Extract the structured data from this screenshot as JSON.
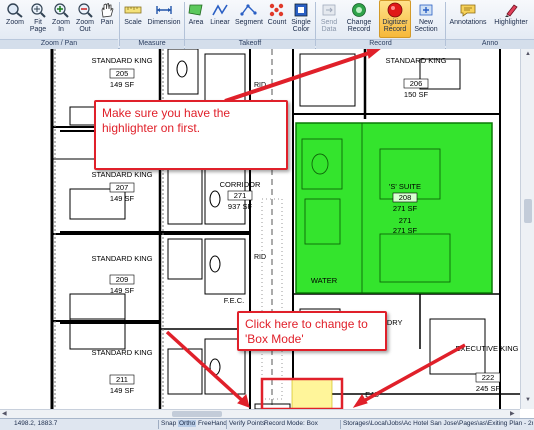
{
  "ribbon": {
    "buttons": [
      {
        "label": "Zoom",
        "icon": "zoom-icon"
      },
      {
        "label": "Fit Page",
        "icon": "fit-page-icon"
      },
      {
        "label": "Zoom In",
        "icon": "zoom-in-icon"
      },
      {
        "label": "Zoom Out",
        "icon": "zoom-out-icon"
      },
      {
        "label": "Pan",
        "icon": "pan-hand-icon"
      },
      {
        "label": "Scale",
        "icon": "scale-icon"
      },
      {
        "label": "Dimension",
        "icon": "dimension-icon"
      },
      {
        "label": "Area",
        "icon": "area-icon"
      },
      {
        "label": "Linear",
        "icon": "linear-icon"
      },
      {
        "label": "Segment",
        "icon": "segment-icon"
      },
      {
        "label": "Count",
        "icon": "count-icon"
      },
      {
        "label": "Single Color",
        "icon": "single-color-icon"
      },
      {
        "label": "Send Data",
        "icon": "send-data-icon"
      },
      {
        "label": "Change Record",
        "icon": "change-record-icon"
      },
      {
        "label": "Digitizer Record",
        "icon": "digitizer-record-icon"
      },
      {
        "label": "New Section",
        "icon": "new-section-icon"
      },
      {
        "label": "Annotations",
        "icon": "annotations-icon"
      },
      {
        "label": "Highlighter",
        "icon": "highlighter-icon"
      }
    ],
    "groups": [
      "Zoom / Pan",
      "Measure",
      "Takeoff",
      "Record",
      "Anno"
    ]
  },
  "plan": {
    "rooms_left": [
      {
        "type": "STANDARD KING",
        "num": "205",
        "area": "149 SF"
      },
      {
        "type": "STANDARD KING",
        "num": "207",
        "area": "149 SF"
      },
      {
        "type": "STANDARD KING",
        "num": "209",
        "area": "149 SF"
      },
      {
        "type": "STANDARD KING",
        "num": "211",
        "area": "149 SF"
      }
    ],
    "room_206": {
      "type": "STANDARD KING",
      "num": "206",
      "area": "150 SF"
    },
    "corridor": {
      "label": "CORRIDOR",
      "num": "271",
      "area": "937 SF"
    },
    "suite": {
      "label": "'S' SUITE",
      "num": "208",
      "area": "271 SF"
    },
    "other_num": "271",
    "other_area": "271 SF",
    "rid": "RID",
    "water": "WATER",
    "fec": "F.E.C.",
    "ndry": "NDRY",
    "ejs": "EJS",
    "exec": {
      "type": "EXECUTIVE KING",
      "num": "222",
      "area": "245 SF"
    }
  },
  "callouts": {
    "highlighter": "Make sure you have the highlighter on first.",
    "boxmode": "Click here to change to 'Box Mode'"
  },
  "status": {
    "coords": "1498.2, 1883.7",
    "snap": "Snap",
    "ortho": "Ortho",
    "freehand": "FreeHand",
    "verify": "Verify Points",
    "record_mode": "Record Mode: Box",
    "path": "Storages\\Local\\Jobs\\Ac Hotel San Jose\\Pages\\as\\Exiting Plan - 2nd Level"
  },
  "colors": {
    "highlight": "#18e010",
    "callout": "#e0202a",
    "active_button": "#f6b83a"
  }
}
